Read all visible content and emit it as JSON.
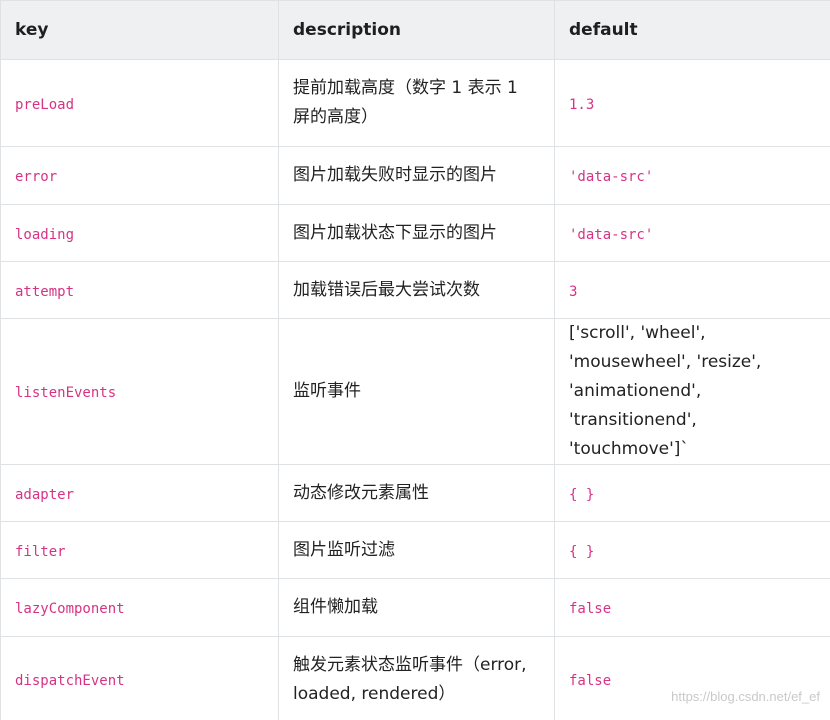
{
  "table": {
    "headers": {
      "key": "key",
      "description": "description",
      "default": "default"
    },
    "rows": [
      {
        "key": "preLoad",
        "description": "提前加载高度（数字 1 表示 1 屏的高度）",
        "default": "1.3",
        "default_kind": "code"
      },
      {
        "key": "error",
        "description": "图片加载失败时显示的图片",
        "default": "'data-src'",
        "default_kind": "code"
      },
      {
        "key": "loading",
        "description": "图片加载状态下显示的图片",
        "default": "'data-src'",
        "default_kind": "code"
      },
      {
        "key": "attempt",
        "description": "加载错误后最大尝试次数",
        "default": "3",
        "default_kind": "code"
      },
      {
        "key": "listenEvents",
        "description": "监听事件",
        "default": "['scroll', 'wheel', 'mousewheel', 'resize', 'animationend', 'transitionend', 'touchmove']`",
        "default_kind": "plain"
      },
      {
        "key": "adapter",
        "description": "动态修改元素属性",
        "default": "{ }",
        "default_kind": "code"
      },
      {
        "key": "filter",
        "description": "图片监听过滤",
        "default": "{ }",
        "default_kind": "code"
      },
      {
        "key": "lazyComponent",
        "description": "组件懒加载",
        "default": "false",
        "default_kind": "code"
      },
      {
        "key": "dispatchEvent",
        "description": "触发元素状态监听事件（error, loaded, rendered）",
        "default": "false",
        "default_kind": "code"
      }
    ]
  },
  "watermark": "https://blog.csdn.net/ef_ef"
}
